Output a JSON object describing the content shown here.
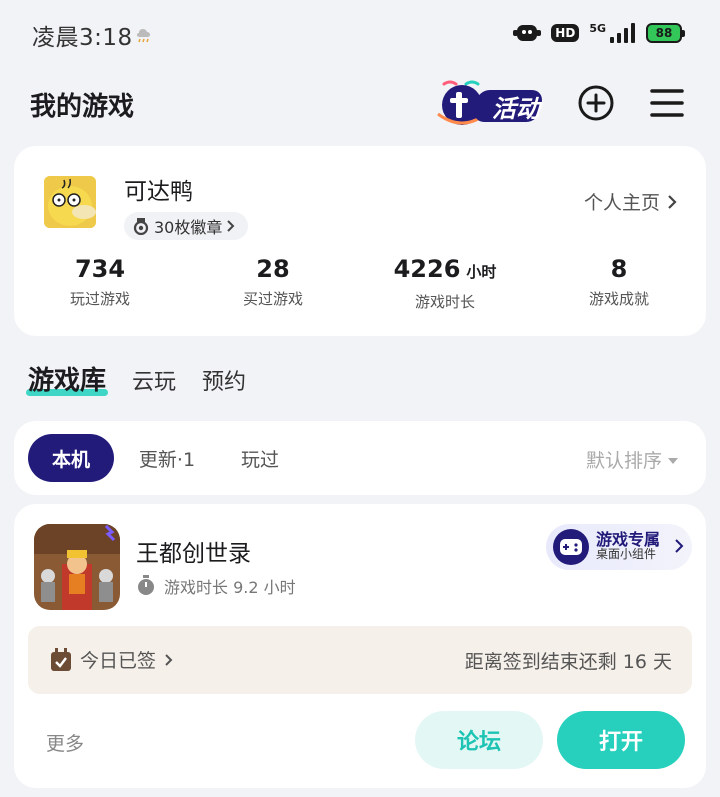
{
  "status_bar": {
    "time": "凌晨3:18",
    "hd": "HD",
    "network": "5G",
    "battery": "88"
  },
  "header": {
    "title": "我的游戏",
    "activity_label": "活动"
  },
  "profile": {
    "name": "可达鸭",
    "badges": "30枚徽章",
    "homepage_link": "个人主页",
    "stats": [
      {
        "value": "734",
        "unit": "",
        "label": "玩过游戏"
      },
      {
        "value": "28",
        "unit": "",
        "label": "买过游戏"
      },
      {
        "value": "4226",
        "unit": "小时",
        "label": "游戏时长"
      },
      {
        "value": "8",
        "unit": "",
        "label": "游戏成就"
      }
    ]
  },
  "library_tabs": [
    {
      "label": "游戏库",
      "active": true
    },
    {
      "label": "云玩",
      "active": false
    },
    {
      "label": "预约",
      "active": false
    }
  ],
  "filters": {
    "chips": [
      "本机",
      "更新·1",
      "玩过"
    ],
    "sort": "默认排序"
  },
  "game": {
    "title": "王都创世录",
    "playtime": "游戏时长 9.2 小时",
    "widget_title": "游戏专属",
    "widget_subtitle": "桌面小组件",
    "checkin_label": "今日已签",
    "checkin_remaining": "距离签到结束还剩 16 天",
    "more": "更多",
    "forum_button": "论坛",
    "open_button": "打开"
  },
  "colors": {
    "accent_navy": "#221b7a",
    "accent_teal": "#27d0bd",
    "background": "#f2f3f7"
  }
}
